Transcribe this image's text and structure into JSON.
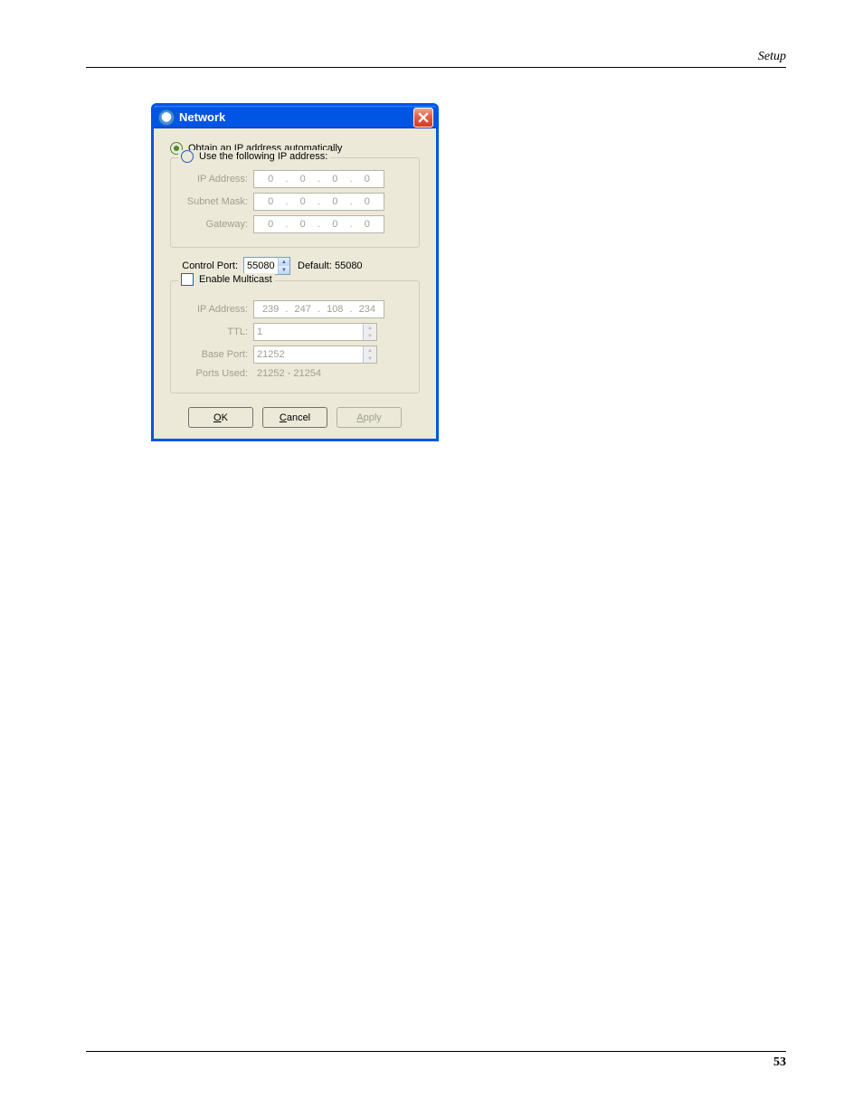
{
  "page": {
    "header_text": "Setup",
    "footer_page": "53"
  },
  "dialog": {
    "title": "Network",
    "radio_obtain": "Obtain an IP address automatically",
    "radio_use": "Use the following IP address:",
    "radio_selected": "obtain",
    "ip_group": {
      "ip_label": "IP Address:",
      "ip_value": [
        "0",
        "0",
        "0",
        "0"
      ],
      "subnet_label": "Subnet Mask:",
      "subnet_value": [
        "0",
        "0",
        "0",
        "0"
      ],
      "gateway_label": "Gateway:",
      "gateway_value": [
        "0",
        "0",
        "0",
        "0"
      ]
    },
    "control_port": {
      "label": "Control Port:",
      "value": "55080",
      "default_text": "Default: 55080"
    },
    "multicast": {
      "checkbox_label": "Enable Multicast",
      "checked": false,
      "ip_label": "IP Address:",
      "ip_value": [
        "239",
        "247",
        "108",
        "234"
      ],
      "ttl_label": "TTL:",
      "ttl_value": "1",
      "baseport_label": "Base Port:",
      "baseport_value": "21252",
      "portsused_label": "Ports Used:",
      "portsused_value": "21252 - 21254"
    },
    "buttons": {
      "ok_u": "O",
      "ok_rest": "K",
      "cancel_u": "C",
      "cancel_rest": "ancel",
      "apply_u": "A",
      "apply_rest": "pply"
    }
  }
}
